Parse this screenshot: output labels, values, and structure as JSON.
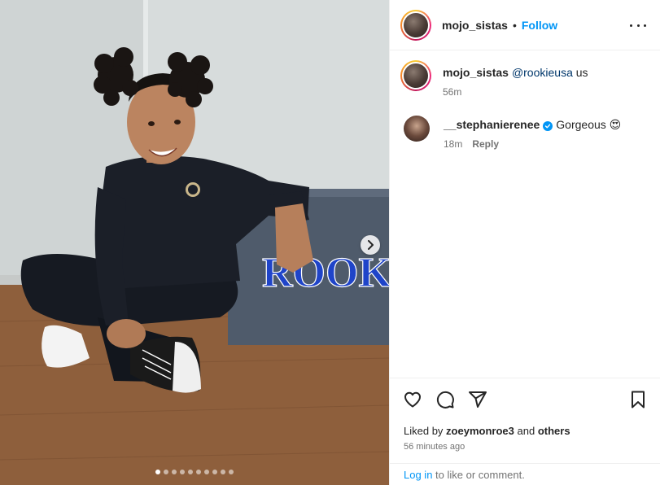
{
  "post": {
    "author": "mojo_sistas",
    "separator": "•",
    "follow_label": "Follow",
    "more_icon": "more-horizontal-icon",
    "carousel": {
      "slide_count": 10,
      "active_index": 0,
      "next_icon": "chevron-right-icon"
    }
  },
  "comments": [
    {
      "username": "mojo_sistas",
      "mention": "@rookieusa",
      "text": " us",
      "time": "56m"
    },
    {
      "username": "__stephanierenee",
      "verified": true,
      "text": "Gorgeous",
      "emoji": "😍",
      "time": "18m",
      "reply_label": "Reply"
    }
  ],
  "actions": {
    "icons": [
      "heart-icon",
      "comment-icon",
      "share-icon",
      "bookmark-icon"
    ],
    "liked_by_prefix": "Liked by",
    "liked_by_user": "zoeymonroe3",
    "liked_by_and": "and",
    "liked_by_others": "others",
    "timestamp": "56 minutes ago"
  },
  "login": {
    "link_label": "Log in",
    "rest": " to like or comment."
  },
  "colors": {
    "accent": "#0095f6",
    "text": "#262626",
    "muted": "#737373",
    "border": "#efefef"
  }
}
